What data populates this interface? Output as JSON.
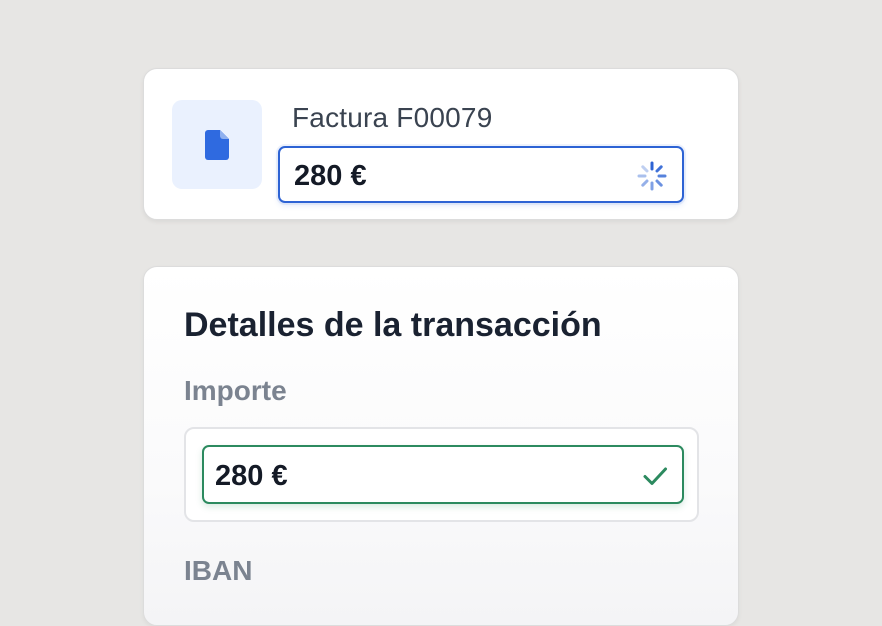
{
  "invoice": {
    "title": "Factura F00079",
    "amount": "280 €",
    "icon": "document-icon",
    "status_icon": "loading-spinner-icon",
    "accent_color": "#2d63d4"
  },
  "details": {
    "title": "Detalles de la transacción",
    "amount_label": "Importe",
    "amount_value": "280 €",
    "amount_status_icon": "checkmark-icon",
    "valid_color": "#2c8a5f",
    "iban_label": "IBAN"
  }
}
